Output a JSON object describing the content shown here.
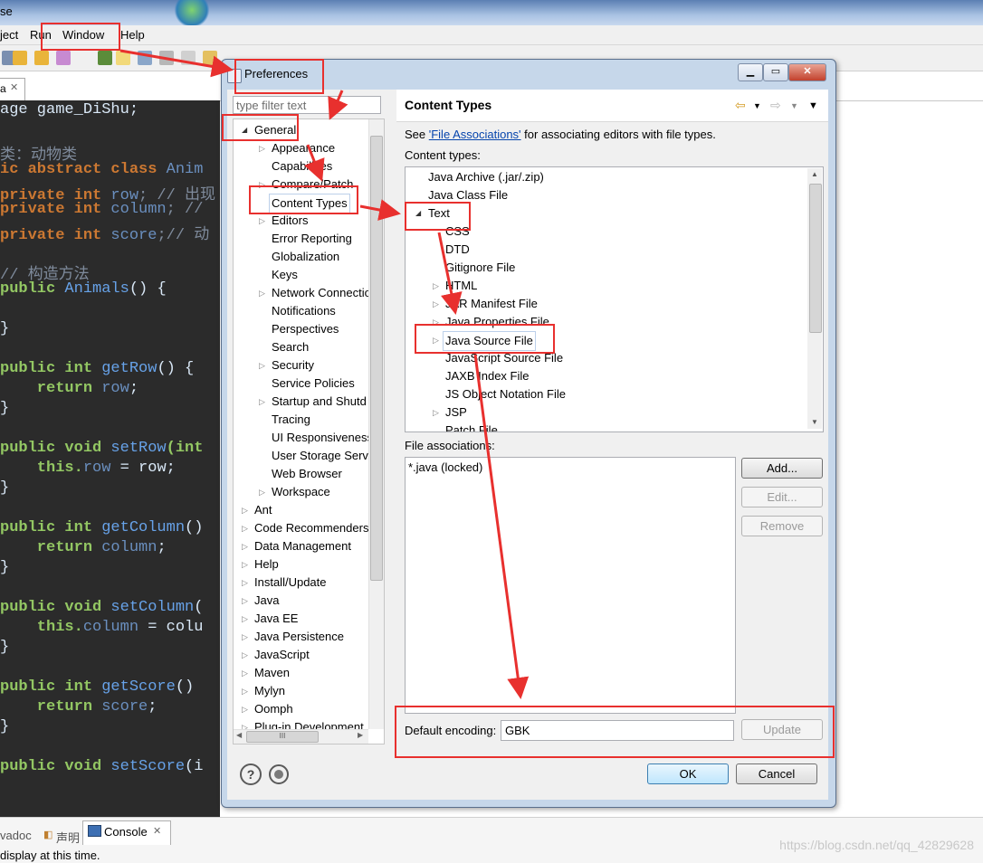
{
  "app": {
    "title_partial": "se"
  },
  "menu": {
    "items": [
      "ject",
      "Run",
      "Window",
      "Help"
    ]
  },
  "editor": {
    "tab_label": "a",
    "lines": [
      {
        "parts": [
          {
            "t": "age game_DiShu;",
            "c": ""
          }
        ]
      },
      {
        "parts": [
          {
            "t": "",
            "c": ""
          }
        ]
      },
      {
        "parts": [
          {
            "t": "类：动物类",
            "c": "cm"
          }
        ]
      },
      {
        "parts": [
          {
            "t": "ic abstract class ",
            "c": "kw"
          },
          {
            "t": "Anim",
            "c": "fld"
          }
        ]
      },
      {
        "parts": [
          {
            "t": "private int ",
            "c": "kw"
          },
          {
            "t": "row",
            "c": "fld"
          },
          {
            "t": "; // 出现",
            "c": "cm"
          }
        ]
      },
      {
        "parts": [
          {
            "t": "private int ",
            "c": "kw"
          },
          {
            "t": "column",
            "c": "fld"
          },
          {
            "t": "; //",
            "c": "cm"
          }
        ]
      },
      {
        "parts": [
          {
            "t": "private int ",
            "c": "kw"
          },
          {
            "t": "score",
            "c": "fld"
          },
          {
            "t": ";// 动",
            "c": "cm"
          }
        ]
      },
      {
        "parts": [
          {
            "t": "",
            "c": ""
          }
        ]
      },
      {
        "parts": [
          {
            "t": "// 构造方法",
            "c": "cm"
          }
        ]
      },
      {
        "parts": [
          {
            "t": "public ",
            "c": "kw2"
          },
          {
            "t": "Animals",
            "c": "meth"
          },
          {
            "t": "() {",
            "c": ""
          }
        ]
      },
      {
        "parts": [
          {
            "t": "",
            "c": ""
          }
        ]
      },
      {
        "parts": [
          {
            "t": "}",
            "c": ""
          }
        ]
      },
      {
        "parts": [
          {
            "t": "",
            "c": ""
          }
        ]
      },
      {
        "parts": [
          {
            "t": "public int ",
            "c": "kw2"
          },
          {
            "t": "getRow",
            "c": "meth"
          },
          {
            "t": "() {",
            "c": ""
          }
        ]
      },
      {
        "parts": [
          {
            "t": "    return ",
            "c": "kw2"
          },
          {
            "t": "row",
            "c": "fld"
          },
          {
            "t": ";",
            "c": ""
          }
        ]
      },
      {
        "parts": [
          {
            "t": "}",
            "c": ""
          }
        ]
      },
      {
        "parts": [
          {
            "t": "",
            "c": ""
          }
        ]
      },
      {
        "parts": [
          {
            "t": "public void ",
            "c": "kw2"
          },
          {
            "t": "setRow",
            "c": "meth"
          },
          {
            "t": "(int",
            "c": "kw2"
          }
        ]
      },
      {
        "parts": [
          {
            "t": "    this.",
            "c": "kw2"
          },
          {
            "t": "row",
            "c": "fld"
          },
          {
            "t": " = row;",
            "c": ""
          }
        ]
      },
      {
        "parts": [
          {
            "t": "}",
            "c": ""
          }
        ]
      },
      {
        "parts": [
          {
            "t": "",
            "c": ""
          }
        ]
      },
      {
        "parts": [
          {
            "t": "public int ",
            "c": "kw2"
          },
          {
            "t": "getColumn",
            "c": "meth"
          },
          {
            "t": "()",
            "c": ""
          }
        ]
      },
      {
        "parts": [
          {
            "t": "    return ",
            "c": "kw2"
          },
          {
            "t": "column",
            "c": "fld"
          },
          {
            "t": ";",
            "c": ""
          }
        ]
      },
      {
        "parts": [
          {
            "t": "}",
            "c": ""
          }
        ]
      },
      {
        "parts": [
          {
            "t": "",
            "c": ""
          }
        ]
      },
      {
        "parts": [
          {
            "t": "public void ",
            "c": "kw2"
          },
          {
            "t": "setColumn",
            "c": "meth"
          },
          {
            "t": "(",
            "c": ""
          }
        ]
      },
      {
        "parts": [
          {
            "t": "    this.",
            "c": "kw2"
          },
          {
            "t": "column",
            "c": "fld"
          },
          {
            "t": " = colu",
            "c": ""
          }
        ]
      },
      {
        "parts": [
          {
            "t": "}",
            "c": ""
          }
        ]
      },
      {
        "parts": [
          {
            "t": "",
            "c": ""
          }
        ]
      },
      {
        "parts": [
          {
            "t": "public int ",
            "c": "kw2"
          },
          {
            "t": "getScore",
            "c": "meth"
          },
          {
            "t": "()",
            "c": ""
          }
        ]
      },
      {
        "parts": [
          {
            "t": "    return ",
            "c": "kw2"
          },
          {
            "t": "score",
            "c": "fld"
          },
          {
            "t": ";",
            "c": ""
          }
        ]
      },
      {
        "parts": [
          {
            "t": "}",
            "c": ""
          }
        ]
      },
      {
        "parts": [
          {
            "t": "",
            "c": ""
          }
        ]
      },
      {
        "parts": [
          {
            "t": "public void ",
            "c": "kw2"
          },
          {
            "t": "setScore",
            "c": "meth"
          },
          {
            "t": "(i",
            "c": ""
          }
        ]
      }
    ]
  },
  "bottom": {
    "tabs": [
      "vadoc",
      "声明",
      "Console"
    ],
    "console_text": "display at this time.",
    "watermark": "https://blog.csdn.net/qq_42829628"
  },
  "dialog": {
    "title": "Preferences",
    "filter_placeholder": "type filter text",
    "tree": [
      {
        "label": "General",
        "level": 0,
        "expanded": true
      },
      {
        "label": "Appearance",
        "level": 1,
        "arrow": true
      },
      {
        "label": "Capabilities",
        "level": 1
      },
      {
        "label": "Compare/Patch",
        "level": 1,
        "arrow": true
      },
      {
        "label": "Content Types",
        "level": 1,
        "selected": true
      },
      {
        "label": "Editors",
        "level": 1,
        "arrow": true
      },
      {
        "label": "Error Reporting",
        "level": 1
      },
      {
        "label": "Globalization",
        "level": 1
      },
      {
        "label": "Keys",
        "level": 1
      },
      {
        "label": "Network Connectio",
        "level": 1,
        "arrow": true
      },
      {
        "label": "Notifications",
        "level": 1
      },
      {
        "label": "Perspectives",
        "level": 1
      },
      {
        "label": "Search",
        "level": 1
      },
      {
        "label": "Security",
        "level": 1,
        "arrow": true
      },
      {
        "label": "Service Policies",
        "level": 1
      },
      {
        "label": "Startup and Shutd",
        "level": 1,
        "arrow": true
      },
      {
        "label": "Tracing",
        "level": 1
      },
      {
        "label": "UI Responsiveness",
        "level": 1
      },
      {
        "label": "User Storage Serv",
        "level": 1
      },
      {
        "label": "Web Browser",
        "level": 1
      },
      {
        "label": "Workspace",
        "level": 1,
        "arrow": true
      },
      {
        "label": "Ant",
        "level": 0,
        "arrow": true
      },
      {
        "label": "Code Recommenders",
        "level": 0,
        "arrow": true
      },
      {
        "label": "Data Management",
        "level": 0,
        "arrow": true
      },
      {
        "label": "Help",
        "level": 0,
        "arrow": true
      },
      {
        "label": "Install/Update",
        "level": 0,
        "arrow": true
      },
      {
        "label": "Java",
        "level": 0,
        "arrow": true
      },
      {
        "label": "Java EE",
        "level": 0,
        "arrow": true
      },
      {
        "label": "Java Persistence",
        "level": 0,
        "arrow": true
      },
      {
        "label": "JavaScript",
        "level": 0,
        "arrow": true
      },
      {
        "label": "Maven",
        "level": 0,
        "arrow": true
      },
      {
        "label": "Mylyn",
        "level": 0,
        "arrow": true
      },
      {
        "label": "Oomph",
        "level": 0,
        "arrow": true
      },
      {
        "label": "Plug-in Development",
        "level": 0,
        "arrow": true
      }
    ],
    "panel_title": "Content Types",
    "see_prefix": "See ",
    "see_link": "'File Associations'",
    "see_suffix": " for associating editors with file types.",
    "content_types_label": "Content types:",
    "content_types": [
      {
        "label": "Java Archive (.jar/.zip)",
        "level": 0
      },
      {
        "label": "Java Class File",
        "level": 0
      },
      {
        "label": "Text",
        "level": 0,
        "expanded": true
      },
      {
        "label": "CSS",
        "level": 1
      },
      {
        "label": "DTD",
        "level": 1
      },
      {
        "label": "Gitignore File",
        "level": 1
      },
      {
        "label": "HTML",
        "level": 1,
        "arrow": true
      },
      {
        "label": "JAR Manifest File",
        "level": 1,
        "arrow": true
      },
      {
        "label": "Java Properties File",
        "level": 1,
        "arrow": true
      },
      {
        "label": "Java Source File",
        "level": 1,
        "arrow": true,
        "selected": true
      },
      {
        "label": "JavaScript Source File",
        "level": 1
      },
      {
        "label": "JAXB Index File",
        "level": 1
      },
      {
        "label": "JS Object Notation File",
        "level": 1
      },
      {
        "label": "JSP",
        "level": 1,
        "arrow": true
      },
      {
        "label": "Patch File",
        "level": 1
      }
    ],
    "file_assoc_label": "File associations:",
    "file_assocs": [
      "*.java (locked)"
    ],
    "add_label": "Add...",
    "edit_label": "Edit...",
    "remove_label": "Remove",
    "encoding_label": "Default encoding:",
    "encoding_value": "GBK",
    "update_label": "Update",
    "ok_label": "OK",
    "cancel_label": "Cancel"
  },
  "colors": {
    "annotation": "#e8302e",
    "editor_bg": "#2b2b2b",
    "dialog_frame": "#c6d7ea"
  }
}
